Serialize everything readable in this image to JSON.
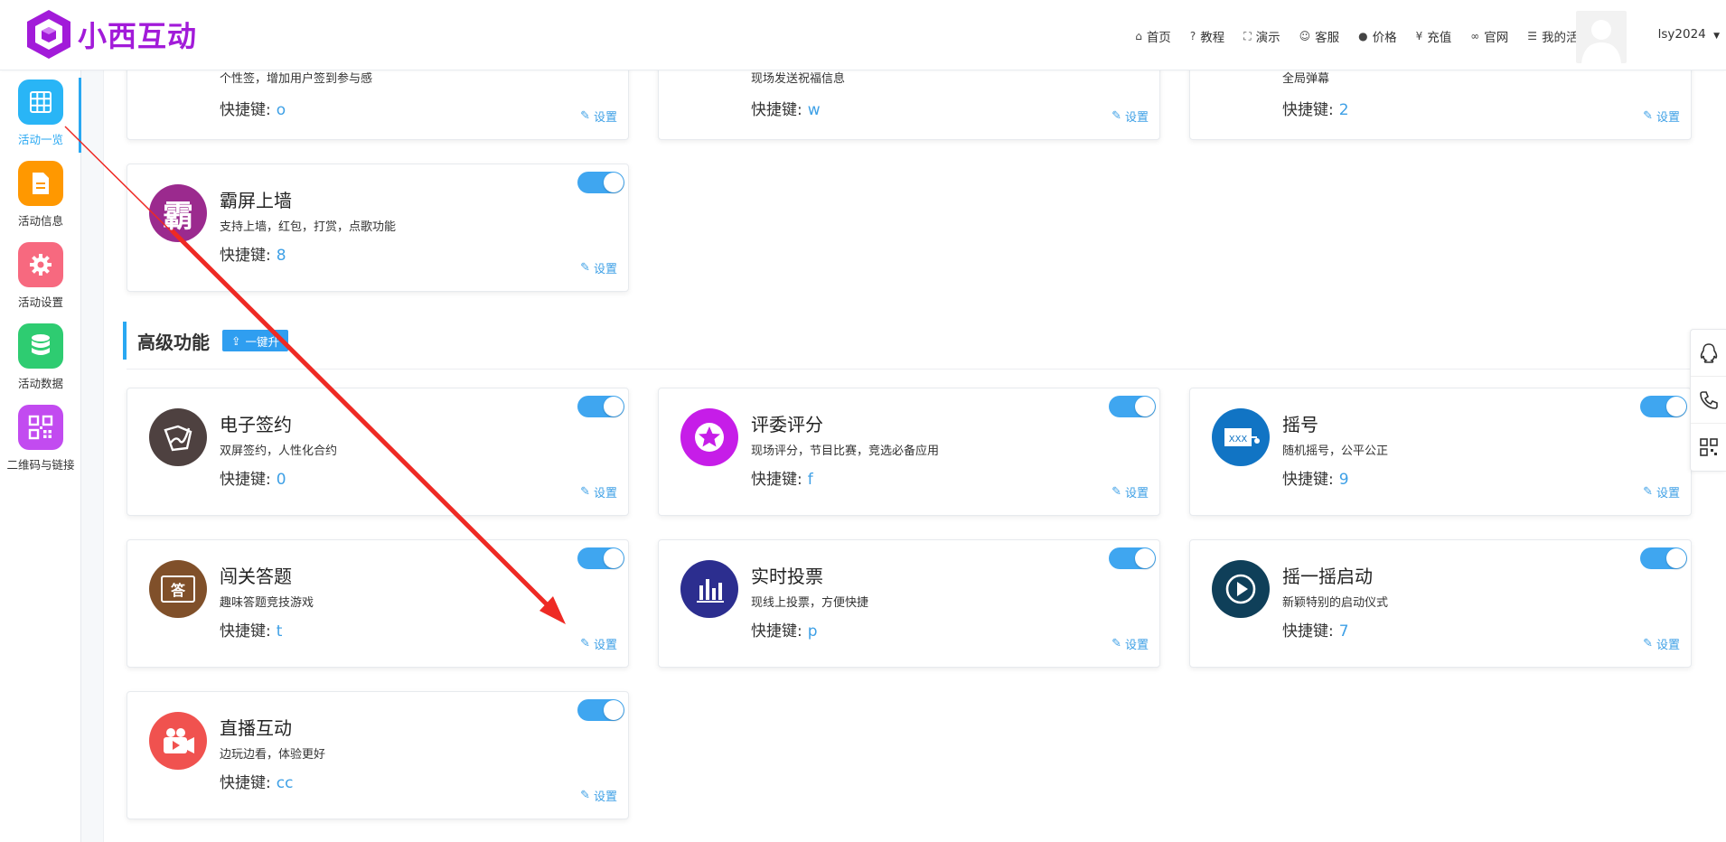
{
  "brand": {
    "name": "小西互动"
  },
  "nav": {
    "items": [
      {
        "icon": "home-icon",
        "label": "首页"
      },
      {
        "icon": "help-icon",
        "label": "教程"
      },
      {
        "icon": "fullscreen-icon",
        "label": "演示"
      },
      {
        "icon": "smile-icon",
        "label": "客服"
      },
      {
        "icon": "info-icon",
        "label": "价格"
      },
      {
        "icon": "yen-icon",
        "label": "充值"
      },
      {
        "icon": "link-icon",
        "label": "官网"
      },
      {
        "icon": "list-icon",
        "label": "我的活动"
      }
    ],
    "username": "lsy2024"
  },
  "sidebar": {
    "items": [
      {
        "label": "活动一览",
        "icon": "grid-icon",
        "color": "#29b5f6",
        "active": true
      },
      {
        "label": "活动信息",
        "icon": "document-icon",
        "color": "#ff9800"
      },
      {
        "label": "活动设置",
        "icon": "gear-icon",
        "color": "#f7697f"
      },
      {
        "label": "活动数据",
        "icon": "database-icon",
        "color": "#2ecc71"
      },
      {
        "label": "二维码与链接",
        "icon": "qrcode-icon",
        "color": "#c24bf0"
      }
    ]
  },
  "common": {
    "key_label": "快捷键:",
    "settings_label": "设置"
  },
  "top_cards": [
    {
      "desc": "个性签，增加用户签到参与感",
      "key": "o"
    },
    {
      "desc": "现场发送祝福信息",
      "key": "w"
    },
    {
      "desc": "全局弹幕",
      "key": "2"
    }
  ],
  "single_card": {
    "title": "霸屏上墙",
    "desc": "支持上墙，红包，打赏，点歌功能",
    "key": "8",
    "icon": "bapin-icon",
    "icon_text": "霸",
    "color": "#9b2a8e"
  },
  "section": {
    "title": "高级功能",
    "upgrade_label": "一键升"
  },
  "advanced_cards": [
    {
      "title": "电子签约",
      "desc": "双屏签约，人性化合约",
      "key": "0",
      "icon": "sign-icon",
      "color": "#4e4140"
    },
    {
      "title": "评委评分",
      "desc": "现场评分，节目比赛，竞选必备应用",
      "key": "f",
      "icon": "star-icon",
      "color": "#c61de8"
    },
    {
      "title": "摇号",
      "desc": "随机摇号，公平公正",
      "key": "9",
      "icon": "lottery-icon",
      "color": "#1174c4"
    },
    {
      "title": "闯关答题",
      "desc": "趣味答题竞技游戏",
      "key": "t",
      "icon": "quiz-icon",
      "icon_text": "答",
      "color": "#80502a"
    },
    {
      "title": "实时投票",
      "desc": "现线上投票，方便快捷",
      "key": "p",
      "icon": "chart-icon",
      "color": "#2c2e8f"
    },
    {
      "title": "摇一摇启动",
      "desc": "新颖特别的启动仪式",
      "key": "7",
      "icon": "play-icon",
      "color": "#0f3f59"
    },
    {
      "title": "直播互动",
      "desc": "边玩边看，体验更好",
      "key": "cc",
      "icon": "live-icon",
      "color": "#f0524f"
    }
  ],
  "float_tools": [
    {
      "icon": "qq-icon"
    },
    {
      "icon": "phone-icon"
    },
    {
      "icon": "qrcode-small-icon"
    }
  ],
  "colors": {
    "accent": "#29a8f2",
    "toggle_on": "#3fa6f0",
    "arrow": "#ee2a24"
  }
}
